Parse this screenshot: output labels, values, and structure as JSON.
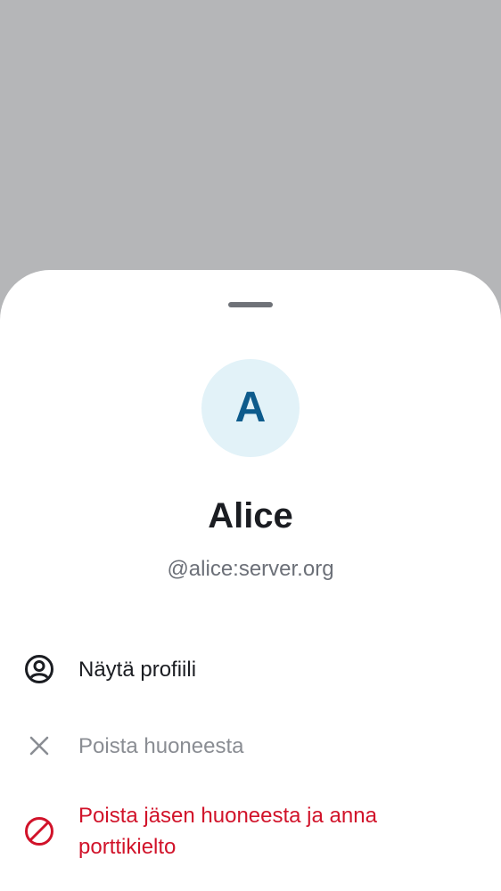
{
  "profile": {
    "avatar_letter": "A",
    "display_name": "Alice",
    "user_id": "@alice:server.org"
  },
  "actions": [
    {
      "label": "Näytä profiili",
      "icon": "user-profile-icon",
      "state": "enabled",
      "color": "#1b1d22"
    },
    {
      "label": "Poista huoneesta",
      "icon": "close-icon",
      "state": "disabled",
      "color": "#8a8d93"
    },
    {
      "label": "Poista jäsen huoneesta ja anna porttikielto",
      "icon": "block-icon",
      "state": "destructive",
      "color": "#d1132a"
    }
  ],
  "colors": {
    "scrim": "#b5b6b8",
    "sheet": "#ffffff",
    "avatar_bg": "#e2f2f8",
    "avatar_fg": "#0d5b8c",
    "destructive": "#d1132a"
  }
}
